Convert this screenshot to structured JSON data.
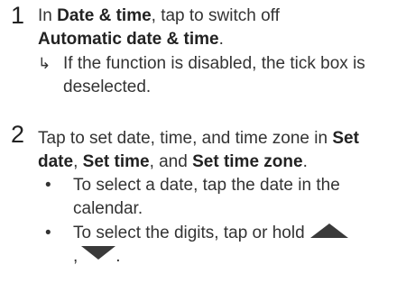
{
  "steps": [
    {
      "number": "1",
      "text_pre": "In ",
      "bold1": "Date & time",
      "text_mid": ", tap to switch off",
      "bold2": "Automatic date & time",
      "text_post": ".",
      "result_arrow": "↳",
      "result_text": "If the function is disabled, the tick box is deselected."
    },
    {
      "number": "2",
      "text_pre": "Tap to set date, time, and time zone in ",
      "bold1": "Set date",
      "sep1": ", ",
      "bold2": "Set time",
      "sep2": ", and ",
      "bold3": "Set time zone",
      "text_post": ".",
      "bullets": [
        {
          "dot": "•",
          "text": "To select a date, tap the date in the calendar."
        },
        {
          "dot": "•",
          "text_pre": "To select the digits, tap or hold",
          "comma": ",",
          "period": "."
        }
      ]
    }
  ],
  "icons": {
    "up": "triangle-up-icon",
    "down": "triangle-down-icon"
  }
}
